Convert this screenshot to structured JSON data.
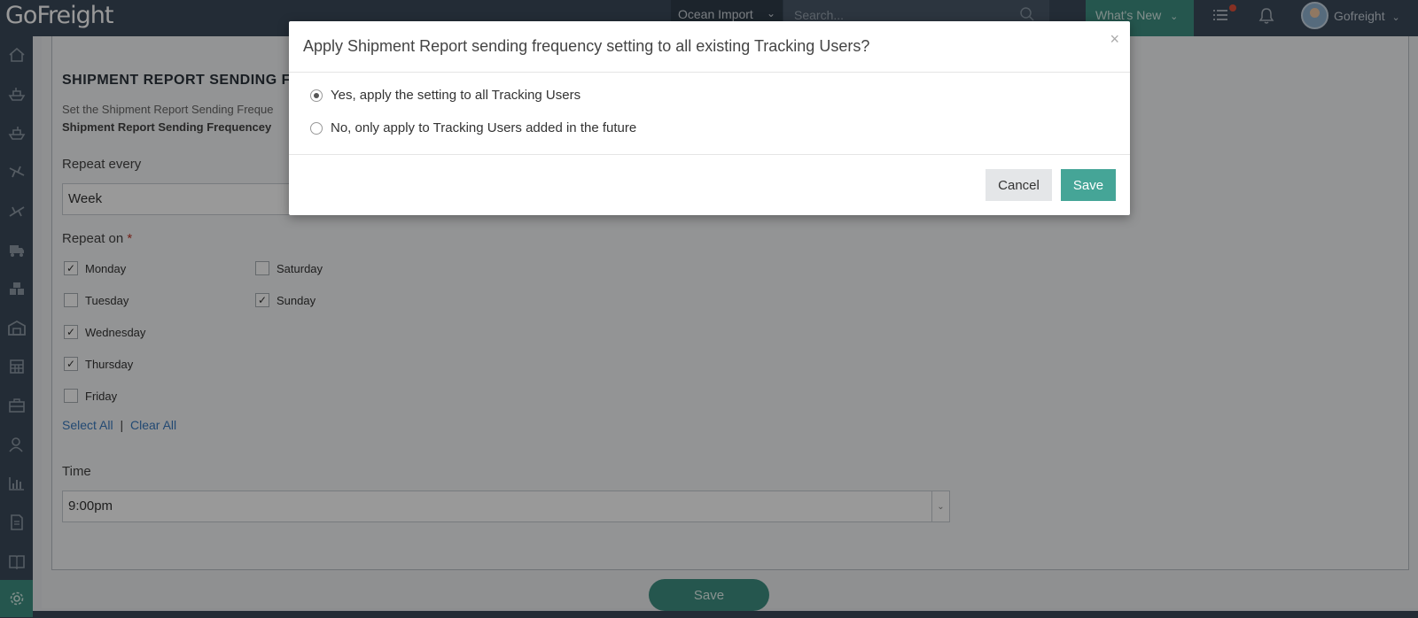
{
  "app": {
    "logo": "GoFreight"
  },
  "topbar": {
    "module": "Ocean Import",
    "search_placeholder": "Search...",
    "whats_new": "What's New",
    "user_name": "Gofreight"
  },
  "page": {
    "section_title": "SHIPMENT REPORT SENDING FR",
    "description": "Set the Shipment Report Sending Freque",
    "description_bold": "Shipment Report Sending Frequencey",
    "repeat_every_label": "Repeat every",
    "repeat_every_value": "Week",
    "repeat_on_label": "Repeat on",
    "required_mark": "*",
    "days": [
      {
        "label": "Monday",
        "checked": true,
        "mark": "✓"
      },
      {
        "label": "Tuesday",
        "checked": false,
        "mark": ""
      },
      {
        "label": "Wednesday",
        "checked": true,
        "mark": "✓"
      },
      {
        "label": "Thursday",
        "checked": true,
        "mark": "✓"
      },
      {
        "label": "Friday",
        "checked": false,
        "mark": ""
      },
      {
        "label": "Saturday",
        "checked": false,
        "mark": ""
      },
      {
        "label": "Sunday",
        "checked": true,
        "mark": "✓"
      }
    ],
    "select_all": "Select All",
    "separator": "|",
    "clear_all": "Clear All",
    "time_label": "Time",
    "time_value": "9:00pm",
    "save_button": "Save"
  },
  "modal": {
    "title": "Apply Shipment Report sending frequency setting to all existing Tracking Users?",
    "close": "×",
    "options": [
      {
        "label": "Yes, apply the setting to all Tracking Users",
        "selected": true
      },
      {
        "label": "No, only apply to Tracking Users added in the future",
        "selected": false
      }
    ],
    "cancel": "Cancel",
    "save": "Save"
  },
  "colors": {
    "topbar": "#3b4a5a",
    "accent": "#3f8f82",
    "save_button": "#45a597"
  }
}
